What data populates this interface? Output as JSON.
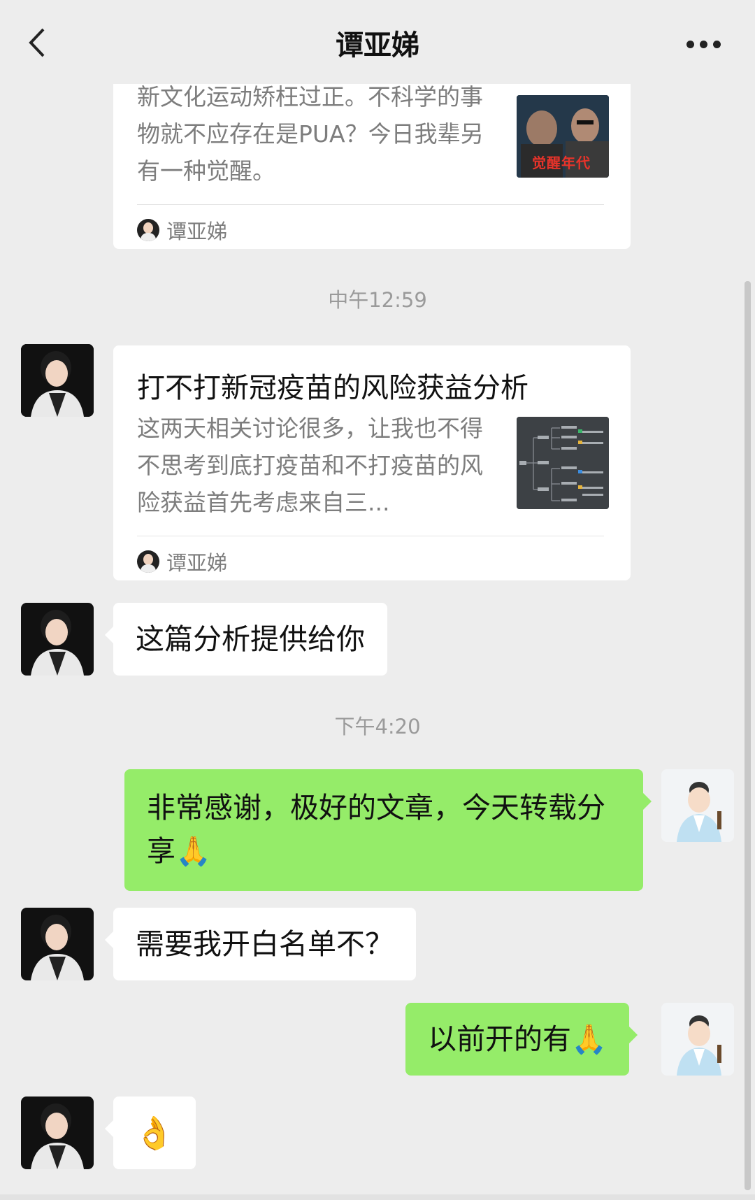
{
  "header": {
    "title": "谭亚娣",
    "back_icon": "chevron-left-icon",
    "more_icon": "more-horizontal-icon"
  },
  "messages": {
    "card1": {
      "desc": "新文化运动矫枉过正。不科学的事物就不应存在是PUA？今日我辈另有一种觉醒。",
      "thumb_text": "觉醒年代",
      "source": "谭亚娣"
    },
    "time1": "中午12:59",
    "card2": {
      "title": "打不打新冠疫苗的风险获益分析",
      "desc": "这两天相关讨论很多，让我也不得不思考到底打疫苗和不打疫苗的风险获益首先考虑来自三...",
      "source": "谭亚娣"
    },
    "msg1": "这篇分析提供给你",
    "time2": "下午4:20",
    "msg2": "非常感谢，极好的文章，今天转载分享🙏",
    "msg3": "需要我开白名单不？",
    "msg4": "以前开的有🙏",
    "msg5": "👌"
  }
}
